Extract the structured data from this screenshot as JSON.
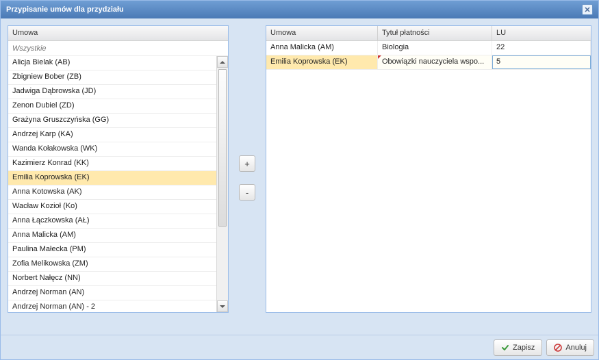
{
  "window": {
    "title": "Przypisanie umów dla przydziału"
  },
  "left": {
    "header": "Umowa",
    "filter_placeholder": "Wszystkie",
    "selected_index": 8,
    "items": [
      "Alicja Bielak (AB)",
      "Zbigniew Bober (ZB)",
      "Jadwiga Dąbrowska (JD)",
      "Zenon Dubiel (ZD)",
      "Grażyna Gruszczyńska (GG)",
      "Andrzej Karp (KA)",
      "Wanda Kołakowska (WK)",
      "Kazimierz Konrad (KK)",
      "Emilia Koprowska (EK)",
      "Anna Kotowska (AK)",
      "Wacław Kozioł (Ko)",
      "Anna Łączkowska (AŁ)",
      "Anna Malicka (AM)",
      "Paulina Małecka (PM)",
      "Zofia Melikowska (ZM)",
      "Norbert Nałęcz (NN)",
      "Andrzej Norman (AN)",
      "Andrzej Norman (AN) - 2"
    ]
  },
  "middle": {
    "add_label": "+",
    "remove_label": "-"
  },
  "right": {
    "columns": {
      "umowa": "Umowa",
      "tytul": "Tytuł płatności",
      "lu": "LU"
    },
    "selected_index": 1,
    "editing_lu_index": 1,
    "rows": [
      {
        "umowa": "Anna Malicka (AM)",
        "tytul": "Biologia",
        "lu": "22"
      },
      {
        "umowa": "Emilia Koprowska (EK)",
        "tytul": "Obowiązki nauczyciela wspo...",
        "lu": "5"
      }
    ]
  },
  "footer": {
    "save": "Zapisz",
    "cancel": "Anuluj"
  }
}
